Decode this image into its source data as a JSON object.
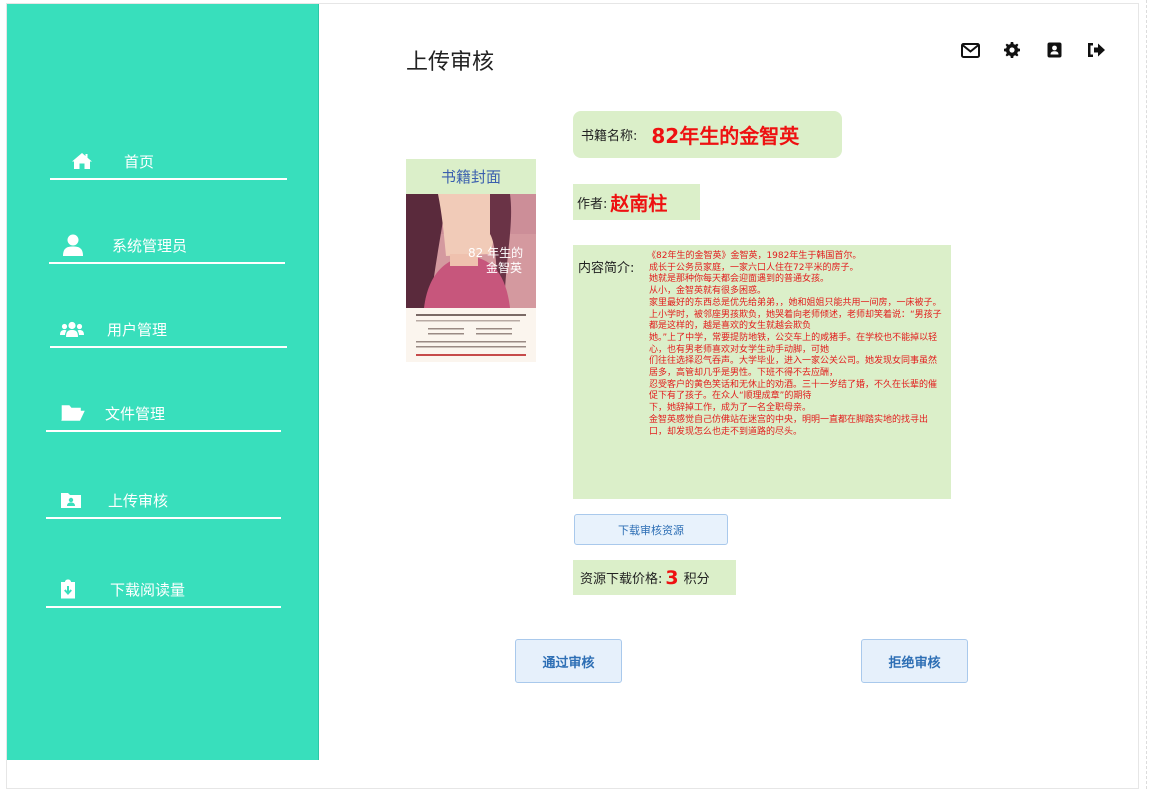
{
  "page": {
    "title": "上传审核"
  },
  "sidebar": {
    "items": [
      {
        "label": "首页",
        "icon": "home-icon"
      },
      {
        "label": "系统管理员",
        "icon": "user-icon"
      },
      {
        "label": "用户管理",
        "icon": "users-icon"
      },
      {
        "label": "文件管理",
        "icon": "folder-open-icon"
      },
      {
        "label": "上传审核",
        "icon": "id-folder-icon"
      },
      {
        "label": "下载阅读量",
        "icon": "clipboard-download-icon"
      }
    ]
  },
  "header_icons": [
    "envelope-icon",
    "gear-icon",
    "address-book-icon",
    "sign-out-icon"
  ],
  "book": {
    "cover_label": "书籍封面",
    "cover_title_text": "82年生的\n金智英",
    "name_label": "书籍名称:",
    "name": "82年生的金智英",
    "author_label": "作者:",
    "author": "赵南柱",
    "intro_label": "内容简介:",
    "intro_lines": [
      "《82年生的金智英》金智英，1982年生于韩国首尔。",
      "成长于公务员家庭，一家六口人住在72平米的房子。",
      "她就是那种你每天都会迎面遇到的普通女孩。",
      "从小，金智英就有很多困惑。",
      "家里最好的东西总是优先给弟弟，，她和姐姐只能共用一间房，一床被子。",
      "上小学时，被邻座男孩欺负，她哭着向老师倾述，老师却笑着说：“男孩子都是这样的，越是喜欢的女生就越会欺负",
      "她。”上了中学，常要提防地铁，公交车上的咸猪手。在学校也不能掉以轻心，也有男老师喜欢对女学生动手动脚，可她",
      "们往往选择忍气吞声。大学毕业，进入一家公关公司。她发现女同事虽然居多，高管却几乎是男性。下班不得不去应酬，",
      "忍受客户的黄色笑话和无休止的劝酒。三十一岁结了婚，不久在长辈的催促下有了孩子。在众人“顺理成章”的期待",
      "下，她辞掉工作，成为了一名全职母亲。",
      "金智英感觉自己仿佛站在迷宫的中央，明明一直都在脚踏实地的找寻出口，却发现怎么也走不到道路的尽头。"
    ]
  },
  "actions": {
    "download_label": "下载审核资源",
    "price_label": "资源下载价格:",
    "price_value": "3",
    "price_unit": "积分",
    "approve_label": "通过审核",
    "reject_label": "拒绝审核"
  },
  "colors": {
    "sidebar": "#38dfbc",
    "panel": "#dbefc9",
    "highlight": "#ee1111",
    "button": "#e6f0fb"
  }
}
